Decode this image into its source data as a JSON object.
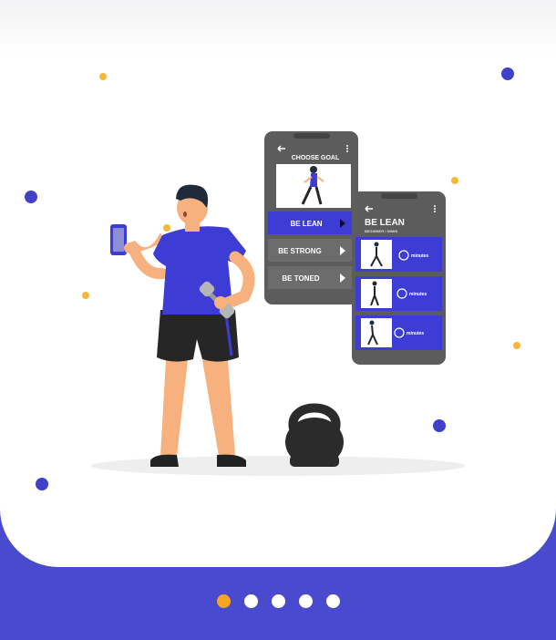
{
  "illustration": {
    "phone1": {
      "title": "CHOOSE GOAL",
      "options": [
        "BE LEAN",
        "BE STRONG",
        "BE TONED"
      ],
      "selected_index": 0
    },
    "phone2": {
      "title": "BE LEAN",
      "subtitle": "BEGINNER / 30MIN",
      "exercises": [
        {
          "icon": "timer-icon",
          "label": "minutes"
        },
        {
          "icon": "timer-icon",
          "label": "minutes"
        },
        {
          "icon": "timer-icon",
          "label": "minutes"
        }
      ]
    }
  },
  "pager": {
    "total": 5,
    "active_index": 0
  },
  "colors": {
    "brand": "#4a4acf",
    "accent": "#f5a623",
    "phone_body": "#5c5c5c",
    "shirt": "#3d3dd6"
  }
}
